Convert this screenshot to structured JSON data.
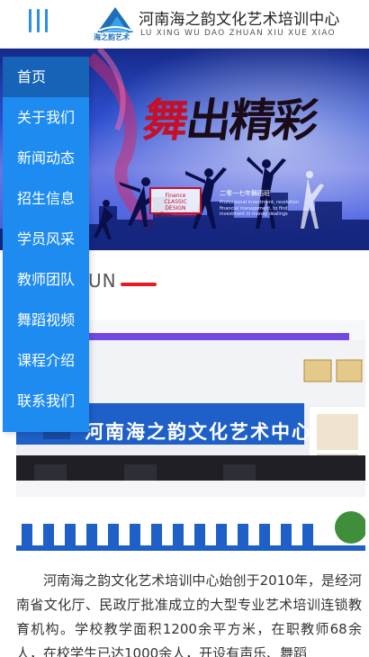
{
  "header": {
    "menu_icon": "hamburger-icon",
    "logo_caption": "海之韵艺术",
    "title": "河南海之韵文化艺术培训中心",
    "subtitle": "LU XING WU DAO ZHUAN XIU XUE XIAO"
  },
  "banner": {
    "title_part1": "舞",
    "title_part2": "出精彩",
    "box_line1": "Finance",
    "box_line2": "CLASSIC DESIGN",
    "box_line3": "追寻自由舞蹈精神",
    "sub": "二零一七年舞蹈班",
    "text": "Professional investment, resolution financial management, to find investment in money dealings"
  },
  "section": {
    "heading_en": "UN"
  },
  "photo": {
    "sign_text": "河南海之韵文化艺术中心"
  },
  "intro": {
    "text": "河南海之韵文化艺术培训中心始创于2010年，是经河南省文化厅、民政厅批准成立的大型专业艺术培训连锁教育机构。学校教学面积1200余平方米，在职教师68余人，在校学生已达1000余人，开设有声乐、舞蹈"
  },
  "nav": {
    "items": [
      {
        "label": "首页",
        "active": true
      },
      {
        "label": "关于我们"
      },
      {
        "label": "新闻动态"
      },
      {
        "label": "招生信息"
      },
      {
        "label": "学员风采"
      },
      {
        "label": "教师团队"
      },
      {
        "label": "舞蹈视频"
      },
      {
        "label": "课程介绍"
      },
      {
        "label": "联系我们"
      }
    ]
  },
  "colors": {
    "nav_bg": "#1d8bf0",
    "nav_active": "#1763b8",
    "accent_red": "#e51b23",
    "menu_icon": "#2b8fe6"
  }
}
